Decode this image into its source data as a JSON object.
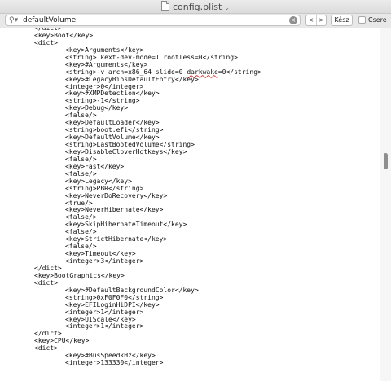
{
  "window": {
    "title": "config.plist"
  },
  "find": {
    "query": "defaultVolume",
    "prev_label": "<",
    "next_label": ">",
    "done_label": "Kész",
    "replace_label": "Csere",
    "replace_checked": false
  },
  "lines": [
    {
      "indent": 0,
      "text": "</dict>"
    },
    {
      "indent": 0,
      "text": "<key>Boot</key>"
    },
    {
      "indent": 0,
      "text": "<dict>"
    },
    {
      "indent": 1,
      "text": "<key>Arguments</key>"
    },
    {
      "indent": 1,
      "text": "<string> kext-dev-mode=1 rootless=0</string>"
    },
    {
      "indent": 1,
      "text": "<key>#Arguments</key>"
    },
    {
      "indent": 1,
      "pre": "<string>-v arch=x86_64 slide=0 ",
      "mark": "darkwake",
      "post": "=0</string>"
    },
    {
      "indent": 1,
      "text": "<key>#LegacyBiosDefaultEntry</key>"
    },
    {
      "indent": 1,
      "text": "<integer>0</integer>"
    },
    {
      "indent": 1,
      "text": "<key>#XMPDetection</key>"
    },
    {
      "indent": 1,
      "text": "<string>-1</string>"
    },
    {
      "indent": 1,
      "text": "<key>Debug</key>"
    },
    {
      "indent": 1,
      "text": "<false/>"
    },
    {
      "indent": 1,
      "text": "<key>DefaultLoader</key>"
    },
    {
      "indent": 1,
      "text": "<string>boot.efi</string>"
    },
    {
      "indent": 1,
      "text": "<key>DefaultVolume</key>"
    },
    {
      "indent": 1,
      "text": "<string>LastBootedVolume</string>"
    },
    {
      "indent": 1,
      "text": "<key>DisableCloverHotkeys</key>"
    },
    {
      "indent": 1,
      "text": "<false/>"
    },
    {
      "indent": 1,
      "text": "<key>Fast</key>"
    },
    {
      "indent": 1,
      "text": "<false/>"
    },
    {
      "indent": 1,
      "text": "<key>Legacy</key>"
    },
    {
      "indent": 1,
      "text": "<string>PBR</string>"
    },
    {
      "indent": 1,
      "text": "<key>NeverDoRecovery</key>"
    },
    {
      "indent": 1,
      "text": "<true/>"
    },
    {
      "indent": 1,
      "text": "<key>NeverHibernate</key>"
    },
    {
      "indent": 1,
      "text": "<false/>"
    },
    {
      "indent": 1,
      "text": "<key>SkipHibernateTimeout</key>"
    },
    {
      "indent": 1,
      "text": "<false/>"
    },
    {
      "indent": 1,
      "text": "<key>StrictHibernate</key>"
    },
    {
      "indent": 1,
      "text": "<false/>"
    },
    {
      "indent": 1,
      "text": "<key>Timeout</key>"
    },
    {
      "indent": 1,
      "text": "<integer>3</integer>"
    },
    {
      "indent": 0,
      "text": "</dict>"
    },
    {
      "indent": 0,
      "text": "<key>BootGraphics</key>"
    },
    {
      "indent": 0,
      "text": "<dict>"
    },
    {
      "indent": 1,
      "text": "<key>#DefaultBackgroundColor</key>"
    },
    {
      "indent": 1,
      "text": "<string>0xF0F0F0</string>"
    },
    {
      "indent": 1,
      "text": "<key>EFILoginHiDPI</key>"
    },
    {
      "indent": 1,
      "text": "<integer>1</integer>"
    },
    {
      "indent": 1,
      "text": "<key>UIScale</key>"
    },
    {
      "indent": 1,
      "text": "<integer>1</integer>"
    },
    {
      "indent": 0,
      "text": "</dict>"
    },
    {
      "indent": 0,
      "text": "<key>CPU</key>"
    },
    {
      "indent": 0,
      "text": "<dict>"
    },
    {
      "indent": 1,
      "text": "<key>#BusSpeedkHz</key>"
    },
    {
      "indent": 1,
      "text": "<integer>133330</integer>"
    }
  ],
  "scroll": {
    "position": 0.37
  }
}
